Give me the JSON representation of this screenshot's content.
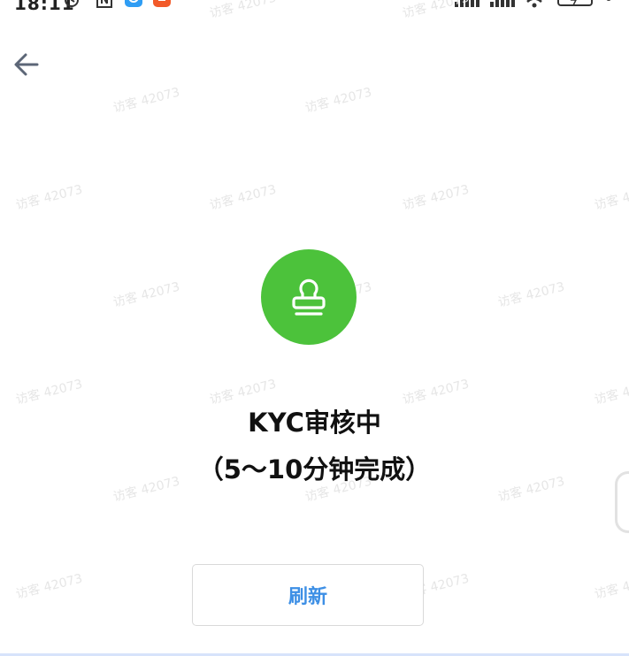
{
  "status_bar": {
    "time": "18:11",
    "icons": [
      "alarm-icon",
      "nfc-icon",
      "app-notification-icon",
      "app-notification-icon",
      "signal-icon",
      "signal-icon",
      "wifi-icon",
      "battery-icon"
    ]
  },
  "nav": {
    "back_icon": "arrow-left-icon"
  },
  "watermark": {
    "text": "访客 42073"
  },
  "status": {
    "icon": "stamp-icon",
    "icon_bg": "#4cc23b",
    "title_line1": "KYC审核中",
    "title_line2": "（5～10分钟完成）"
  },
  "actions": {
    "refresh_label": "刷新",
    "refresh_color": "#3d8fe5"
  }
}
